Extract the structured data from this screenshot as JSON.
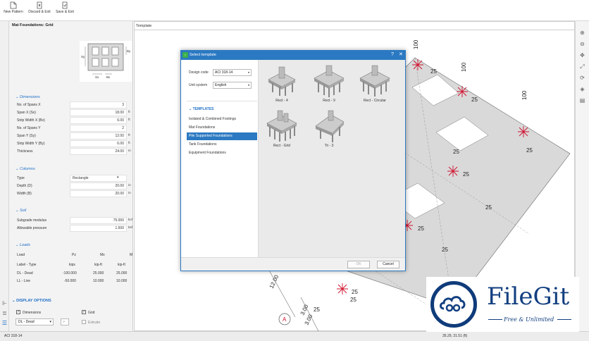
{
  "toolbar": {
    "new_pattern": "New Pattern",
    "discard_exit": "Discard & Exit",
    "save_exit": "Save & Exit"
  },
  "panel": {
    "title": "Mat Foundations: Grid",
    "preview_labels": {
      "sx": "Sx",
      "sy": "Sy",
      "bx": "Bx",
      "by": "By"
    },
    "dimensions": {
      "header": "Dimensions",
      "rows": [
        {
          "label": "No. of Spans X",
          "value": "3",
          "unit": ""
        },
        {
          "label": "Span X (Sx)",
          "value": "18.00",
          "unit": "ft"
        },
        {
          "label": "Strip Width X (Bx)",
          "value": "6.00",
          "unit": "ft"
        },
        {
          "label": "No. of Spans Y",
          "value": "2",
          "unit": ""
        },
        {
          "label": "Span Y (Sy)",
          "value": "12.00",
          "unit": "ft"
        },
        {
          "label": "Strip Width Y (By)",
          "value": "6.00",
          "unit": "ft"
        },
        {
          "label": "Thickness",
          "value": "24.00",
          "unit": "in"
        }
      ]
    },
    "columns": {
      "header": "Columns",
      "rows": [
        {
          "label": "Type",
          "value": "Rectangle",
          "unit": ""
        },
        {
          "label": "Depth (D)",
          "value": "20.00",
          "unit": "in"
        },
        {
          "label": "Width (B)",
          "value": "20.00",
          "unit": "in"
        }
      ]
    },
    "soil": {
      "header": "Soil",
      "rows": [
        {
          "label": "Subgrade modulus",
          "value": "75.000",
          "unit": "kcf"
        },
        {
          "label": "Allowable pressure",
          "value": "1.500",
          "unit": "ksf"
        }
      ]
    },
    "loads": {
      "header": "Loads",
      "columns": [
        "Load",
        "Pz",
        "Mx",
        "My"
      ],
      "units_row": [
        "Label - Type",
        "kips",
        "kip-ft",
        "kip-ft"
      ],
      "rows": [
        [
          "DL - Dead",
          "-100.000",
          "25.000",
          "25.000"
        ],
        [
          "LL - Live",
          "-50.000",
          "10.000",
          "10.000"
        ]
      ]
    },
    "display_options": {
      "header": "DISPLAY OPTIONS",
      "dimensions_label": "Dimensions",
      "grid_label": "Grid",
      "extrude_label": "Extrude",
      "load_select": "DL - Dead",
      "dimensions_checked": "✓",
      "grid_checked": "✓"
    }
  },
  "canvas": {
    "title": "Template",
    "dim_labels": [
      "100",
      "100",
      "100",
      "25",
      "25",
      "25",
      "25",
      "25",
      "25",
      "25",
      "25",
      "25",
      "25",
      "25",
      "12.00",
      "3.00",
      "3.00"
    ],
    "gridline_marker": "A"
  },
  "dialog": {
    "title": "Select template",
    "design_code_label": "Design code",
    "design_code_value": "ACI 318-14",
    "unit_system_label": "Unit system",
    "unit_system_value": "English",
    "templates_header": "TEMPLATES",
    "categories": [
      "Isolated & Combined Footings",
      "Mat Foundations",
      "Pile Supported Foundations",
      "Tank Foundations",
      "Equipment Foundations"
    ],
    "selected_category": "Pile Supported Foundations",
    "tiles": [
      "Rect - 4",
      "Rect - 9",
      "Rect - Circular",
      "Rect - Grid",
      "Tri - 3"
    ],
    "ok_label": "OK",
    "cancel_label": "Cancel",
    "close_glyph": "✕",
    "help_glyph": "?"
  },
  "statusbar": {
    "code": "ACI 318-14",
    "coords": "35.29, 31.51 (ft)"
  },
  "watermark": {
    "brand": "FileGit",
    "tagline": "Free & Unlimited"
  },
  "colors": {
    "accent": "#2b79c2",
    "rebar": "#d0102c",
    "slab": "#d9d9d9",
    "watermark": "#123f80"
  }
}
